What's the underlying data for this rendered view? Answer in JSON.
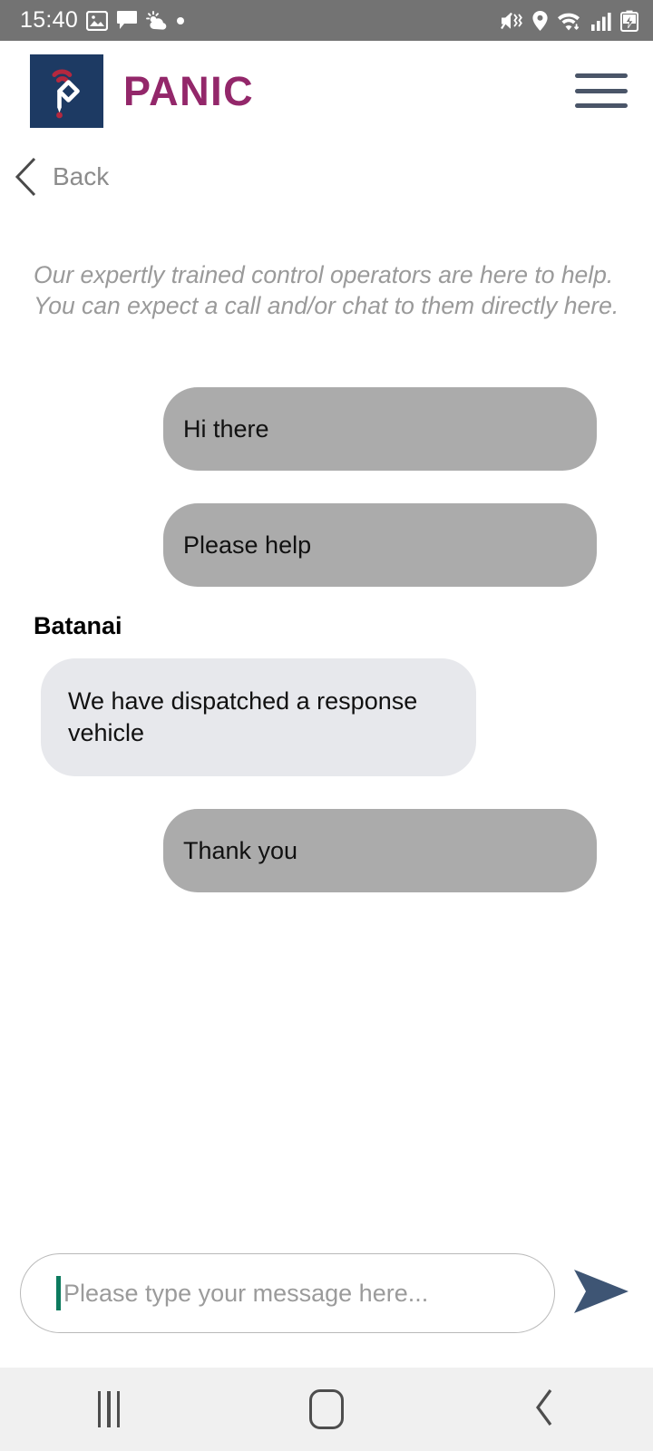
{
  "status_bar": {
    "time": "15:40",
    "left_icons": [
      "image-icon",
      "message-icon",
      "weather-icon",
      "dot-icon"
    ],
    "right_icons": [
      "mute-vibrate-icon",
      "location-icon",
      "wifi-icon",
      "signal-icon",
      "battery-charging-icon"
    ],
    "background_color": "#737373"
  },
  "header": {
    "logo_name": "panic-logo-icon",
    "brand": "PANIC",
    "brand_color": "#93276a",
    "logo_bg_color": "#1d3a63",
    "logo_accent_color": "#b5283f",
    "menu_icon": "hamburger-menu-icon"
  },
  "back": {
    "label": "Back",
    "icon": "chevron-left-icon"
  },
  "intro": {
    "line1": "Our expertly trained control operators are here to help.",
    "line2": "You can expect a call and/or chat to them directly here."
  },
  "chat": {
    "messages": [
      {
        "text": "Hi there",
        "direction": "out"
      },
      {
        "text": "Please help",
        "direction": "out"
      },
      {
        "sender": "Batanai",
        "text": " We have dispatched a response vehicle",
        "direction": "in"
      },
      {
        "text": "Thank you",
        "direction": "out"
      }
    ],
    "outgoing_color": "#ababab",
    "incoming_color": "#e7e8ec"
  },
  "composer": {
    "placeholder": "Please type your message here...",
    "value": "",
    "caret_color": "#0c7a5e",
    "send_icon": "send-arrow-icon",
    "send_color": "#3e5574"
  },
  "nav_bar": {
    "recents_label": "recents-icon",
    "home_label": "home-icon",
    "back_label": "back-icon",
    "background_color": "#f0f0f0"
  }
}
